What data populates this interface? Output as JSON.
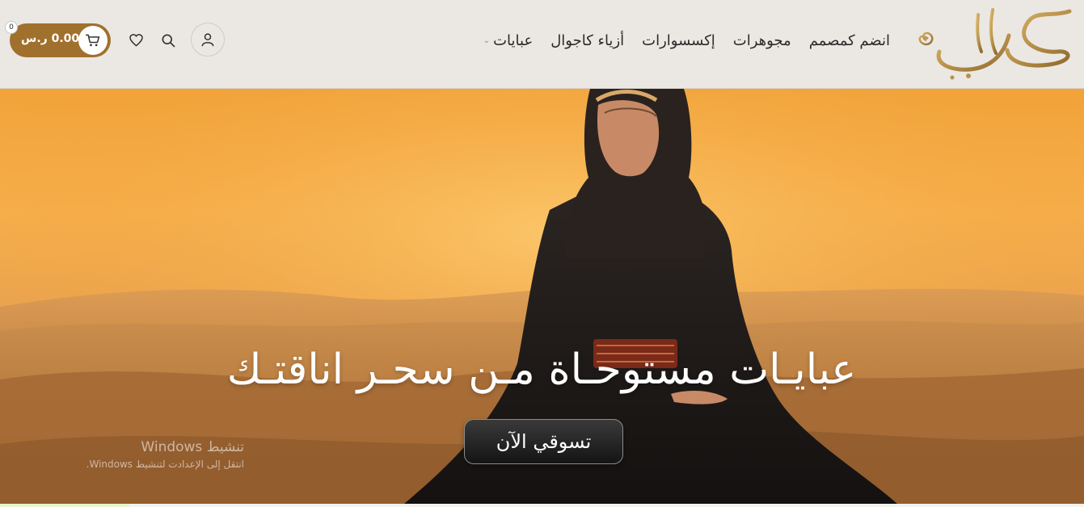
{
  "header": {
    "logo_text": "صبابة",
    "nav": [
      {
        "label": "عبايات",
        "has_dropdown": true
      },
      {
        "label": "أزياء كاجوال"
      },
      {
        "label": "إكسسوارات"
      },
      {
        "label": "مجوهرات"
      },
      {
        "label": "انضم كمصمم"
      }
    ],
    "cart": {
      "amount": "0.00 ر.س",
      "count": "0"
    },
    "icons": [
      "account-icon",
      "search-icon",
      "heart-icon",
      "cart-icon"
    ]
  },
  "hero": {
    "title": "عبايـات مستوحـاة مـن سحـر اناقتـك",
    "cta": "تسوقي الآن"
  },
  "watermark": {
    "title": "تنشيط Windows",
    "subtitle": "انتقل إلى الإعدادت لتنشيط Windows."
  },
  "colors": {
    "header_bg": "#ebe8e3",
    "accent": "#a0702d",
    "logo_gold": "#b8934a",
    "hero_sky": "#f5a83f",
    "button_dark": "#1a1a1a"
  }
}
